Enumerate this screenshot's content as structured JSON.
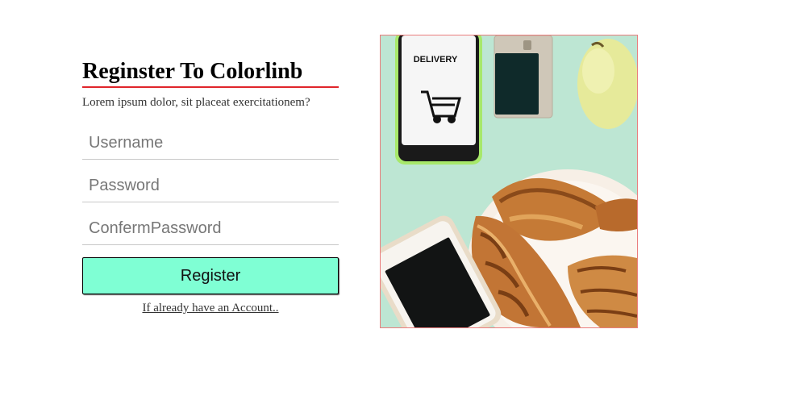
{
  "form": {
    "title": "Reginster To Colorlinb",
    "subtitle": "Lorem ipsum dolor, sit placeat exercitationem?",
    "username_placeholder": "Username",
    "password_placeholder": "Password",
    "confirm_placeholder": "ConfermPassword",
    "register_label": "Register",
    "login_link": "If already have an Account.."
  },
  "colors": {
    "title_underline": "#e0252b",
    "button_background": "#7fffd4",
    "image_border": "#ea7d7d",
    "photo_background": "#b9e3cf"
  },
  "image": {
    "phone_screen_text": "DELIVERY",
    "icons": [
      "shopping-cart-icon"
    ]
  }
}
